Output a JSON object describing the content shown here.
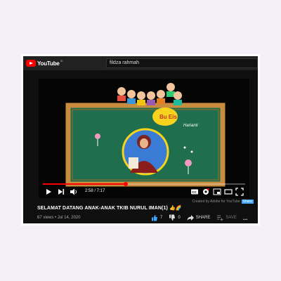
{
  "app": {
    "logo_text": "YouTube",
    "logo_sup": "ID"
  },
  "search": {
    "value": "fildza rahmah"
  },
  "video": {
    "scene_text_1": "Bu Eis",
    "scene_text_2": "Harianti",
    "time": "2:58 / 7:17",
    "progress": 0.41,
    "credit_text": "Created by Adobe for YouTube",
    "credit_link": "Share",
    "title": "SELAMAT DATANG ANAK-ANAK TKIB NURUL IMAN(1) 👍🌈",
    "views": "67 views",
    "date": "Jul 14, 2020",
    "separator": " • ",
    "likes": "7",
    "dislikes": "0",
    "share_label": "SHARE",
    "save_label": "SAVE",
    "more_label": "..."
  },
  "colors": {
    "brand": "#ff0000",
    "board": "#1f6e4e",
    "frame": "#c98b3e",
    "like_active": "#3ea6ff"
  },
  "icons": [
    "youtube-logo-icon",
    "play-icon",
    "next-icon",
    "volume-icon",
    "captions-icon",
    "settings-icon",
    "miniplayer-icon",
    "theater-icon",
    "fullscreen-icon",
    "thumbs-up-icon",
    "thumbs-down-icon",
    "share-icon",
    "save-icon",
    "more-icon"
  ]
}
